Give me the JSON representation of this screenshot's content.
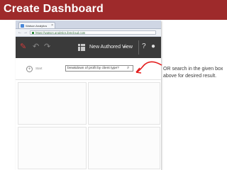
{
  "slide": {
    "title": "Create Dashboard",
    "note": "OR search in the given box above for desired result."
  },
  "browser": {
    "tab_title": "Watson Analytics",
    "tab_close": "×",
    "url": "https://watson.analytics.ibmcloud.com"
  },
  "app": {
    "view_title": "New Authored View",
    "view_caret": "▾",
    "icons": [
      "pencil-icon",
      "undo-icon",
      "redo-icon",
      "grid-icon",
      "question-icon",
      "microphone-icon"
    ]
  },
  "search": {
    "add_symbol": "+",
    "label": "Start",
    "query": "breakdown of profit by client type?",
    "search_glyph": "⌕"
  },
  "colors": {
    "title_bar": "#9e2a2b",
    "app_bar": "#3a3a3a",
    "annotation": "#e31d1d"
  }
}
